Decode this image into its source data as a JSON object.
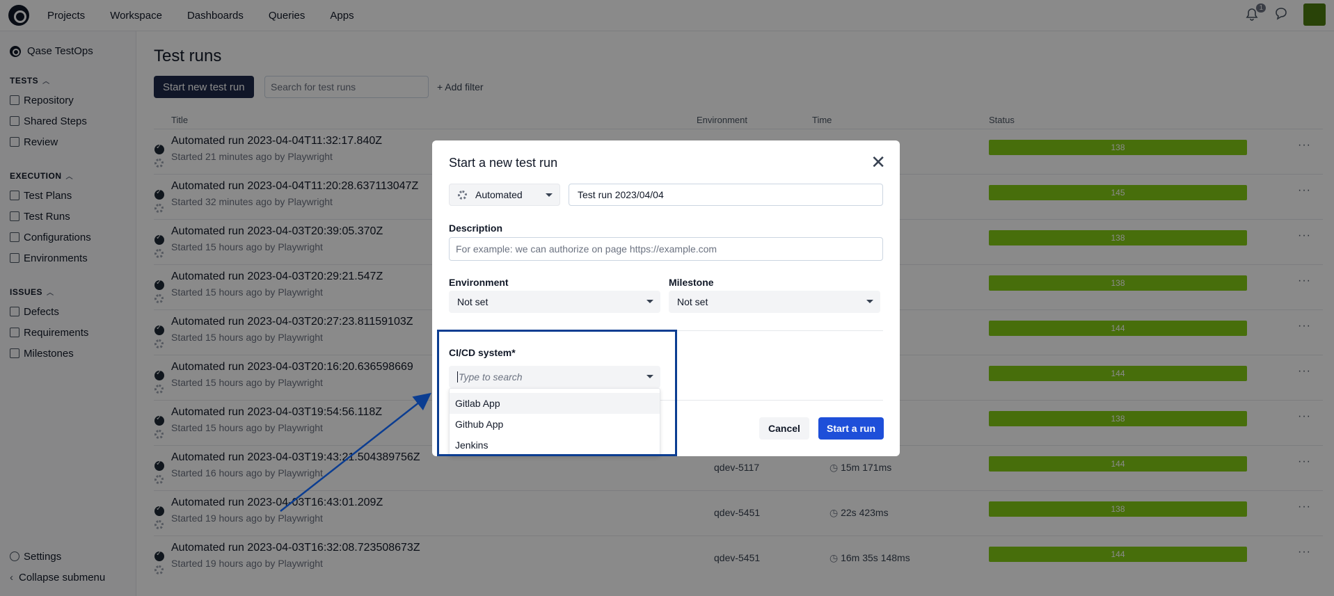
{
  "topnav": {
    "items": [
      "Projects",
      "Workspace",
      "Dashboards",
      "Queries",
      "Apps"
    ],
    "notification_count": "1"
  },
  "sidebar": {
    "brand": "Qase TestOps",
    "tests_header": "TESTS",
    "tests_items": [
      "Repository",
      "Shared Steps",
      "Review"
    ],
    "execution_header": "EXECUTION",
    "execution_items": [
      "Test Plans",
      "Test Runs",
      "Configurations",
      "Environments"
    ],
    "issues_header": "ISSUES",
    "issues_items": [
      "Defects",
      "Requirements",
      "Milestones"
    ],
    "settings": "Settings",
    "collapse": "Collapse submenu"
  },
  "main": {
    "title": "Test runs",
    "start_button": "Start new test run",
    "search_placeholder": "Search for test runs",
    "add_filter": "+ Add filter",
    "columns": {
      "title": "Title",
      "environment": "Environment",
      "time": "Time",
      "status": "Status"
    },
    "rows": [
      {
        "title": "Automated run 2023-04-04T11:32:17.840Z",
        "sub": "Started 21 minutes ago by Playwright",
        "env": "",
        "time": "",
        "count": "138"
      },
      {
        "title": "Automated run 2023-04-04T11:20:28.637113047Z",
        "sub": "Started 32 minutes ago by Playwright",
        "env": "",
        "time": "",
        "count": "145"
      },
      {
        "title": "Automated run 2023-04-03T20:39:05.370Z",
        "sub": "Started 15 hours ago by Playwright",
        "env": "",
        "time": "",
        "count": "138"
      },
      {
        "title": "Automated run 2023-04-03T20:29:21.547Z",
        "sub": "Started 15 hours ago by Playwright",
        "env": "",
        "time": "",
        "count": "138"
      },
      {
        "title": "Automated run 2023-04-03T20:27:23.81159103Z",
        "sub": "Started 15 hours ago by Playwright",
        "env": "",
        "time": "",
        "count": "144"
      },
      {
        "title": "Automated run 2023-04-03T20:16:20.636598669",
        "sub": "Started 15 hours ago by Playwright",
        "env": "",
        "time": "",
        "count": "144"
      },
      {
        "title": "Automated run 2023-04-03T19:54:56.118Z",
        "sub": "Started 15 hours ago by Playwright",
        "env": "",
        "time": "",
        "count": "138"
      },
      {
        "title": "Automated run 2023-04-03T19:43:21.504389756Z",
        "sub": "Started 16 hours ago by Playwright",
        "env": "qdev-5117",
        "time": "15m 171ms",
        "count": "144"
      },
      {
        "title": "Automated run 2023-04-03T16:43:01.209Z",
        "sub": "Started 19 hours ago by Playwright",
        "env": "qdev-5451",
        "time": "22s 423ms",
        "count": "138"
      },
      {
        "title": "Automated run 2023-04-03T16:32:08.723508673Z",
        "sub": "Started 19 hours ago by Playwright",
        "env": "qdev-5451",
        "time": "16m 35s 148ms",
        "count": "144"
      }
    ]
  },
  "modal": {
    "title": "Start a new test run",
    "type_value": "Automated",
    "run_name": "Test run 2023/04/04",
    "description_label": "Description",
    "description_placeholder": "For example: we can authorize on page https://example.com",
    "environment_label": "Environment",
    "environment_value": "Not set",
    "milestone_label": "Milestone",
    "milestone_value": "Not set",
    "cicd_label": "CI/CD system",
    "cicd_required": "*",
    "cicd_placeholder": "Type to search",
    "cicd_options": [
      "Gitlab App",
      "Github App",
      "Jenkins"
    ],
    "cancel": "Cancel",
    "start": "Start a run"
  },
  "colors": {
    "primary": "#1e2a4a",
    "start_blue": "#1e4fd9",
    "status_green": "#84cc16",
    "annotation": "#0b3d91"
  }
}
